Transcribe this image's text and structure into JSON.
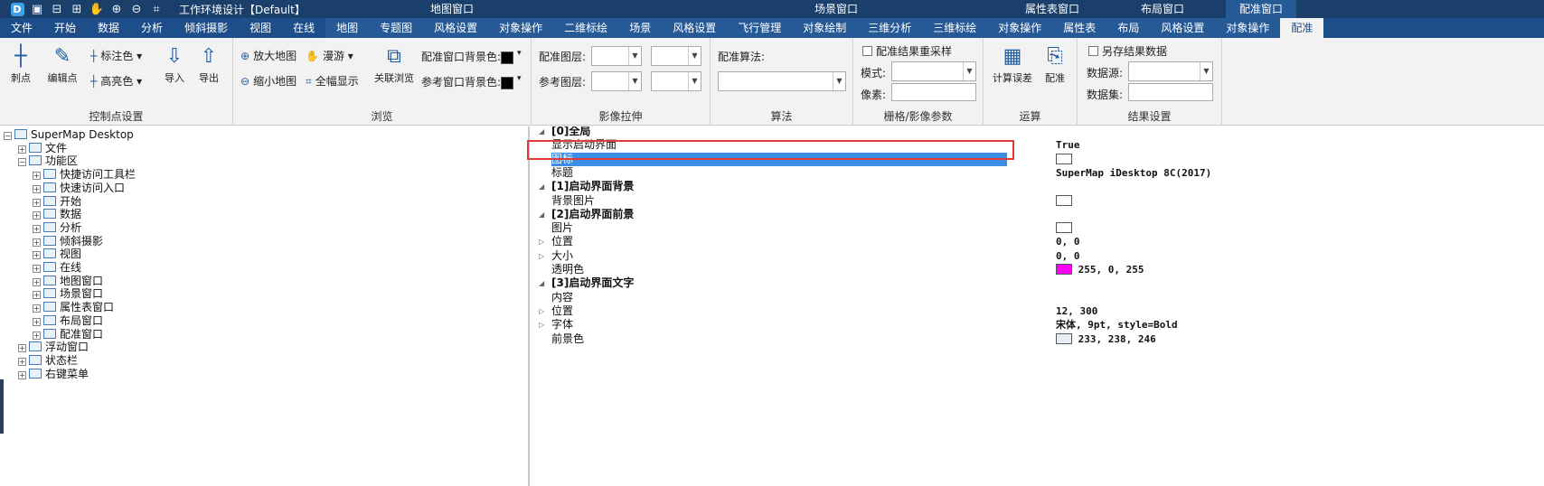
{
  "titlebar": {
    "title": "工作环境设计【Default】",
    "quick_icons": [
      "app-logo-icon",
      "save-icon",
      "open-icon",
      "import-icon",
      "pan-icon",
      "zoom-in-icon",
      "zoom-out-icon",
      "full-extent-icon"
    ],
    "context_titles": [
      "地图窗口",
      "场景窗口",
      "属性表窗口",
      "布局窗口",
      "配准窗口"
    ]
  },
  "tabs": [
    "文件",
    "开始",
    "数据",
    "分析",
    "倾斜摄影",
    "视图",
    "在线",
    "地图",
    "专题图",
    "风格设置",
    "对象操作",
    "二维标绘",
    "场景",
    "风格设置",
    "飞行管理",
    "对象绘制",
    "三维分析",
    "三维标绘",
    "对象操作",
    "属性表",
    "布局",
    "风格设置",
    "对象操作",
    "配准"
  ],
  "active_tab": "配准",
  "ribbon": {
    "control_points": {
      "label": "控制点设置",
      "btn_draw": "刺点",
      "btn_edit": "编辑点",
      "btn_color": "标注色",
      "btn_highlight": "高亮色",
      "btn_import": "导入",
      "btn_export": "导出"
    },
    "browse": {
      "label": "浏览",
      "zoom_in": "放大地图",
      "zoom_out": "缩小地图",
      "pan": "漫游",
      "full": "全幅显示",
      "link": "关联浏览",
      "bg1": "配准窗口背景色:",
      "bg2": "参考窗口背景色:"
    },
    "stretch": {
      "label": "影像拉伸",
      "layer1": "配准图层:",
      "layer2": "参考图层:"
    },
    "algorithm": {
      "label": "算法",
      "title": "配准算法:"
    },
    "raster": {
      "label": "栅格/影像参数",
      "resample": "配准结果重采样",
      "mode": "模式:",
      "pixel": "像素:"
    },
    "compute": {
      "label": "运算",
      "calc": "计算误差",
      "register": "配准"
    },
    "result": {
      "label": "结果设置",
      "save_as": "另存结果数据",
      "datasource": "数据源:",
      "dataset": "数据集:"
    }
  },
  "tree": [
    {
      "text": "SuperMap Desktop",
      "level": 0,
      "exp": "⊟"
    },
    {
      "text": "文件",
      "level": 1,
      "exp": "⊞"
    },
    {
      "text": "功能区",
      "level": 1,
      "exp": "⊟"
    },
    {
      "text": "快捷访问工具栏",
      "level": 2,
      "exp": "⊞"
    },
    {
      "text": "快速访问入口",
      "level": 2,
      "exp": "⊞"
    },
    {
      "text": "开始",
      "level": 2,
      "exp": "⊞"
    },
    {
      "text": "数据",
      "level": 2,
      "exp": "⊞"
    },
    {
      "text": "分析",
      "level": 2,
      "exp": "⊞"
    },
    {
      "text": "倾斜摄影",
      "level": 2,
      "exp": "⊞"
    },
    {
      "text": "视图",
      "level": 2,
      "exp": "⊞"
    },
    {
      "text": "在线",
      "level": 2,
      "exp": "⊞"
    },
    {
      "text": "地图窗口",
      "level": 2,
      "exp": "⊞"
    },
    {
      "text": "场景窗口",
      "level": 2,
      "exp": "⊞"
    },
    {
      "text": "属性表窗口",
      "level": 2,
      "exp": "⊞"
    },
    {
      "text": "布局窗口",
      "level": 2,
      "exp": "⊞"
    },
    {
      "text": "配准窗口",
      "level": 2,
      "exp": "⊞"
    },
    {
      "text": "浮动窗口",
      "level": 1,
      "exp": "⊞"
    },
    {
      "text": "状态栏",
      "level": 1,
      "exp": "⊞"
    },
    {
      "text": "右键菜单",
      "level": 1,
      "exp": "⊞"
    }
  ],
  "props": [
    {
      "name": "[0]全局",
      "type": "cat"
    },
    {
      "name": "显示启动界面",
      "value": "True"
    },
    {
      "name": "图标",
      "value": "",
      "box": "#ffffff",
      "sel": true
    },
    {
      "name": "标题",
      "value": "SuperMap iDesktop 8C(2017)"
    },
    {
      "name": "[1]启动界面背景",
      "type": "cat"
    },
    {
      "name": "背景图片",
      "value": "",
      "box": "#ffffff"
    },
    {
      "name": "[2]启动界面前景",
      "type": "cat"
    },
    {
      "name": "图片",
      "value": "",
      "box": "#ffffff"
    },
    {
      "name": "位置",
      "value": "0, 0",
      "expand": true
    },
    {
      "name": "大小",
      "value": "0, 0",
      "expand": true
    },
    {
      "name": "透明色",
      "value": "255, 0, 255",
      "box": "#ff00ff"
    },
    {
      "name": "[3]启动界面文字",
      "type": "cat"
    },
    {
      "name": "内容",
      "value": ""
    },
    {
      "name": "位置",
      "value": "12, 300",
      "expand": true
    },
    {
      "name": "字体",
      "value": "宋体, 9pt, style=Bold",
      "expand": true
    },
    {
      "name": "前景色",
      "value": "233, 238, 246",
      "box": "#e9eef6"
    }
  ]
}
